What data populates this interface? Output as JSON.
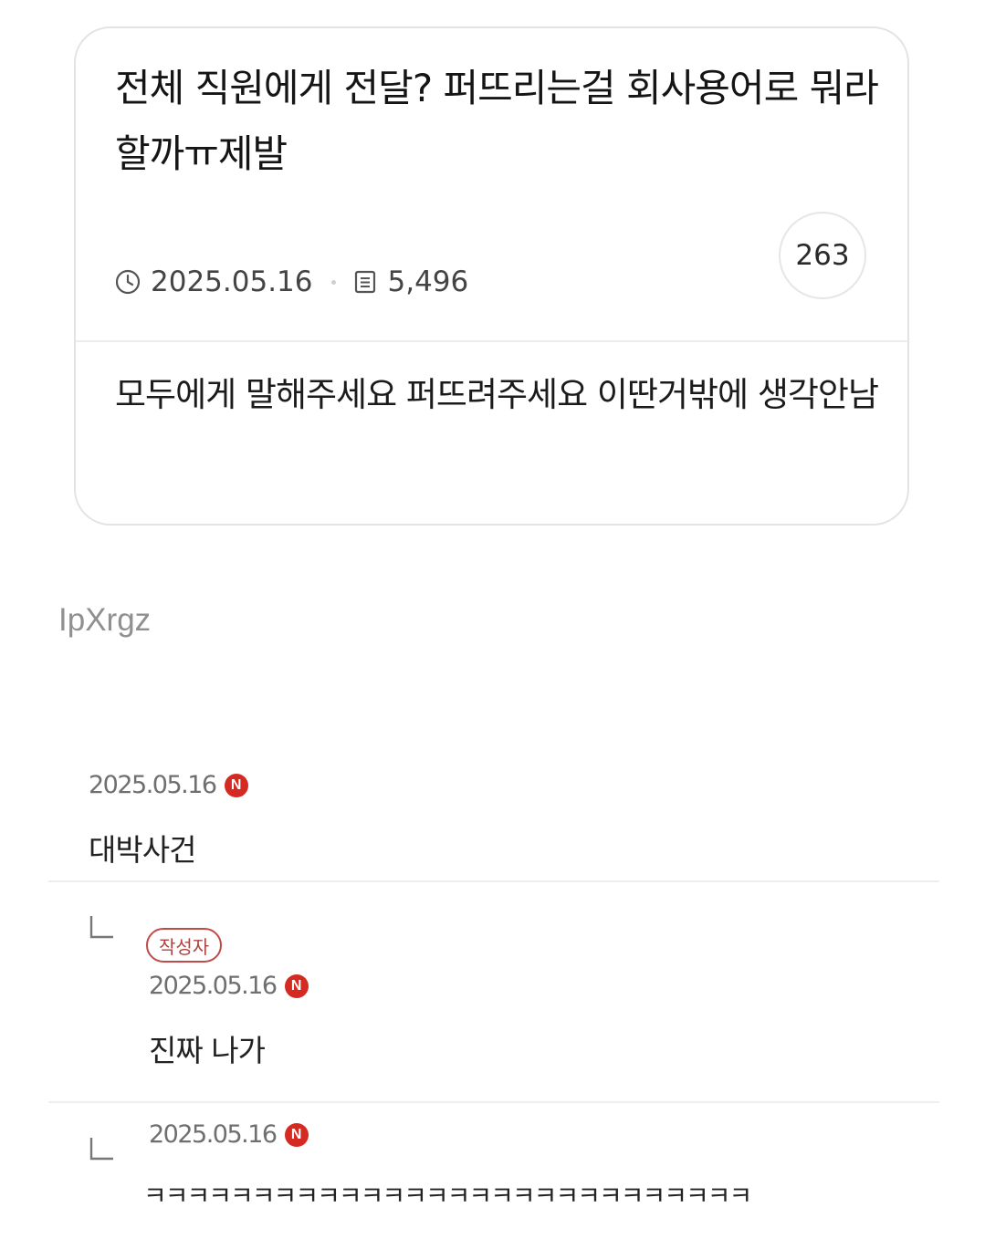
{
  "post": {
    "title": "전체 직원에게 전달? 퍼뜨리는걸 회사용어로 뭐라할까ㅠ제발",
    "date": "2025.05.16",
    "views": "5,496",
    "comment_count": "263",
    "body": "모두에게 말해주세요 퍼뜨려주세요 이딴거밖에 생각안남"
  },
  "watermark": "IpXrgz",
  "comments": [
    {
      "date": "2025.05.16",
      "badge": "N",
      "text": "대박사건"
    },
    {
      "author_label": "작성자",
      "date": "2025.05.16",
      "badge": "N",
      "text": "진짜 나가"
    },
    {
      "date": "2025.05.16",
      "badge": "N",
      "text": "ㅋㅋㅋㅋㅋㅋㅋㅋㅋㅋㅋㅋㅋㅋㅋㅋㅋㅋㅋㅋㅋㅋㅋㅋㅋㅋㅋㅋ"
    }
  ],
  "colors": {
    "new_badge": "#d52a22",
    "author_badge": "#b0413e"
  },
  "icons": {
    "date": "clock-icon",
    "views": "document-icon",
    "new": "new-badge-icon",
    "reply": "reply-arrow-icon"
  }
}
